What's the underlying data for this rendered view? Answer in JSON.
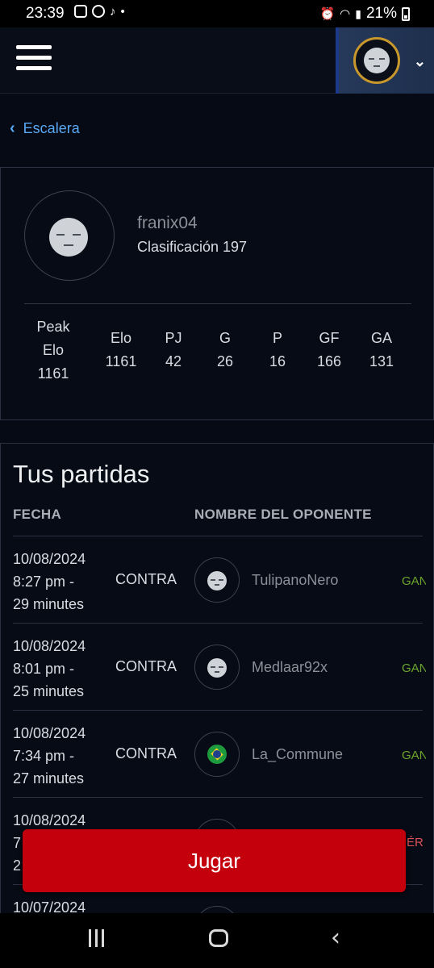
{
  "status_bar": {
    "time": "23:39",
    "battery": "21%"
  },
  "header": {
    "menu_icon": "hamburger-icon",
    "profile_icon": "avatar-face",
    "dropdown_icon": "chevron-down-icon"
  },
  "breadcrumb": {
    "label": "Escalera"
  },
  "profile": {
    "username": "franix04",
    "ranking": "Clasificación 197",
    "stats": [
      {
        "label": "Peak\nElo",
        "value": "1161"
      },
      {
        "label": "Elo",
        "value": "1161"
      },
      {
        "label": "PJ",
        "value": "42"
      },
      {
        "label": "G",
        "value": "26"
      },
      {
        "label": "P",
        "value": "16"
      },
      {
        "label": "GF",
        "value": "166"
      },
      {
        "label": "GA",
        "value": "131"
      }
    ]
  },
  "matches": {
    "title": "Tus partidas",
    "columns": [
      "FECHA",
      "NOMBRE DEL OPONENTE"
    ],
    "rows": [
      {
        "date": "10/08/2024",
        "time": "8:27 pm -",
        "duration": "29 minutes",
        "vs": "CONTRA",
        "opponent": "TulipanoNero",
        "result": "GANADO"
      },
      {
        "date": "10/08/2024",
        "time": "8:01 pm -",
        "duration": "25 minutes",
        "vs": "CONTRA",
        "opponent": "Medlaar92x",
        "result": "GANADO"
      },
      {
        "date": "10/08/2024",
        "time": "7:34 pm -",
        "duration": "27 minutes",
        "vs": "CONTRA",
        "opponent": "La_Commune",
        "result": "GANADO"
      },
      {
        "date": "10/08/2024",
        "time": "7",
        "duration": "2",
        "vs": "",
        "opponent": "",
        "result": "PÉRDIDA"
      },
      {
        "date": "10/07/2024",
        "time": "",
        "duration": "",
        "vs": "",
        "opponent": "",
        "result": ""
      }
    ]
  },
  "play_button": {
    "label": "Jugar"
  },
  "colors": {
    "background": "#050a14",
    "accent_link": "#5aa9f5",
    "win": "#6aa62d",
    "loss": "#e0525a",
    "play": "#c4000d"
  }
}
